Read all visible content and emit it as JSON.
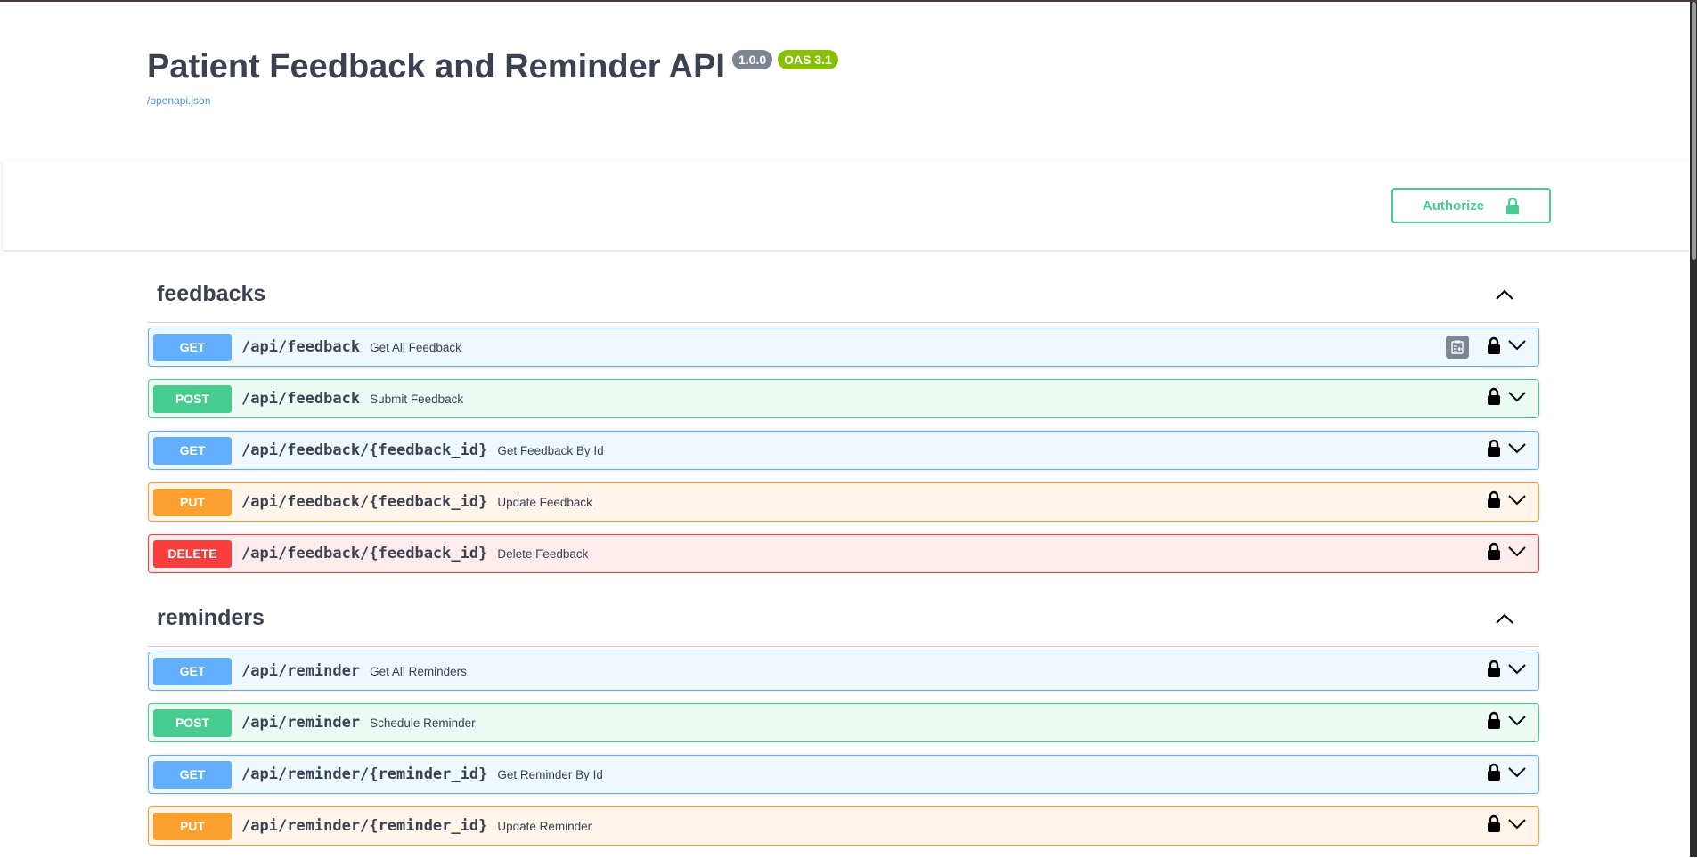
{
  "info": {
    "title": "Patient Feedback and Reminder API",
    "version": "1.0.0",
    "oas": "OAS 3.1",
    "spec_link": "/openapi.json"
  },
  "scheme": {
    "authorize_label": "Authorize"
  },
  "colors": {
    "get": "#61affe",
    "post": "#49cc90",
    "put": "#fca130",
    "delete": "#f93e3e"
  },
  "tags": [
    {
      "name": "feedbacks",
      "operations": [
        {
          "method": "GET",
          "path": "/api/feedback",
          "summary": "Get All Feedback"
        },
        {
          "method": "POST",
          "path": "/api/feedback",
          "summary": "Submit Feedback"
        },
        {
          "method": "GET",
          "path": "/api/feedback/{feedback_id}",
          "summary": "Get Feedback By Id"
        },
        {
          "method": "PUT",
          "path": "/api/feedback/{feedback_id}",
          "summary": "Update Feedback"
        },
        {
          "method": "DELETE",
          "path": "/api/feedback/{feedback_id}",
          "summary": "Delete Feedback"
        }
      ]
    },
    {
      "name": "reminders",
      "operations": [
        {
          "method": "GET",
          "path": "/api/reminder",
          "summary": "Get All Reminders"
        },
        {
          "method": "POST",
          "path": "/api/reminder",
          "summary": "Schedule Reminder"
        },
        {
          "method": "GET",
          "path": "/api/reminder/{reminder_id}",
          "summary": "Get Reminder By Id"
        },
        {
          "method": "PUT",
          "path": "/api/reminder/{reminder_id}",
          "summary": "Update Reminder"
        }
      ]
    }
  ]
}
